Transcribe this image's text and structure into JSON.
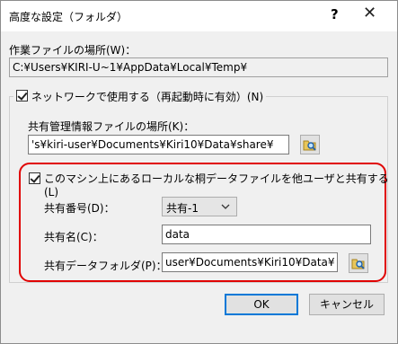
{
  "window": {
    "title": "高度な設定（フォルダ）",
    "help_label": "?",
    "close_label": "✕"
  },
  "work_folder": {
    "label": "作業ファイルの場所(W)：",
    "value": "C:¥Users¥KIRI-U~1¥AppData¥Local¥Temp¥"
  },
  "network": {
    "checkbox_label": "ネットワークで使用する（再起動時に有効）(N)",
    "checked": true,
    "mgmt_label": "共有管理情報ファイルの場所(K)：",
    "mgmt_value": "'s¥kiri-user¥Documents¥Kiri10¥Data¥share¥"
  },
  "share": {
    "checkbox_label": "このマシン上にあるローカルな桐データファイルを他ユーザと共有する(L)",
    "checked": true,
    "number_label": "共有番号(D)：",
    "number_value": "共有-1",
    "name_label": "共有名(C)：",
    "name_value": "data",
    "folder_label": "共有データフォルダ(P)：",
    "folder_value": "user¥Documents¥Kiri10¥Data¥"
  },
  "buttons": {
    "ok": "OK",
    "cancel": "キャンセル"
  },
  "colors": {
    "highlight_border": "#e00000",
    "default_button_border": "#0078d7"
  },
  "icons": {
    "browse": "folder-search-icon",
    "dropdown": "chevron-down-icon"
  }
}
